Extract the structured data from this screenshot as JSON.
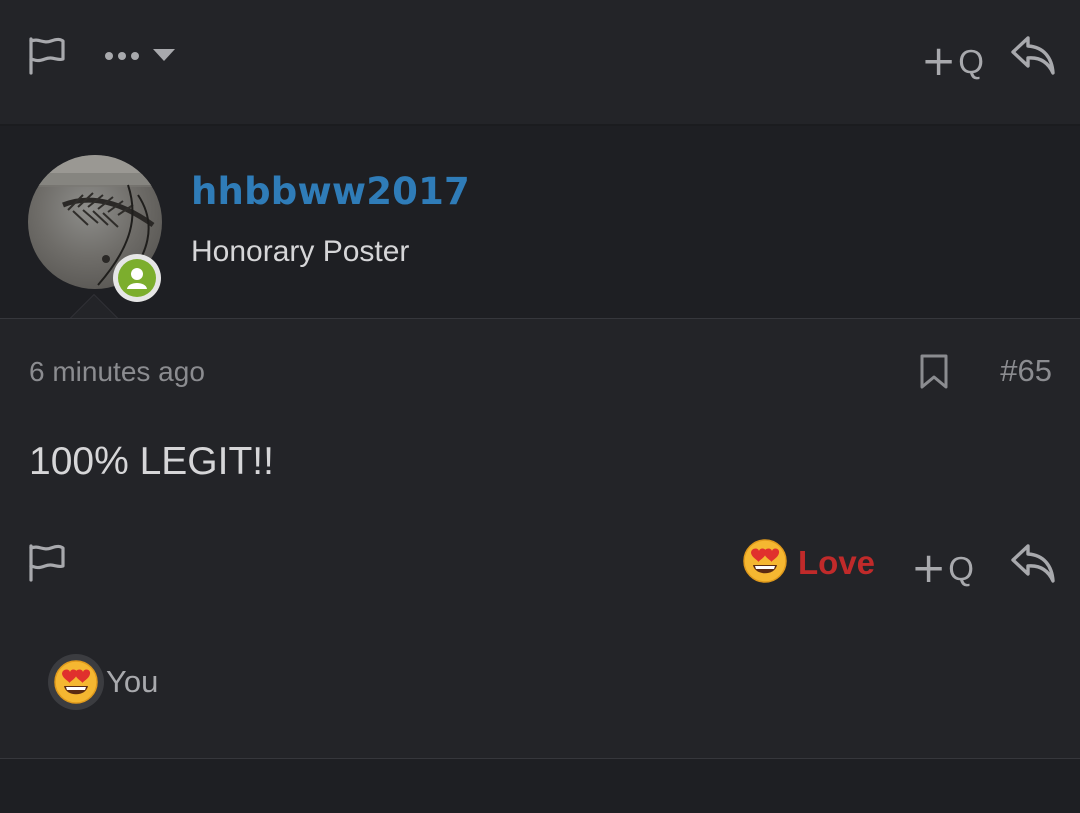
{
  "top_bar": {
    "flag_icon": "flag-icon",
    "more_icon": "ellipsis-icon",
    "more_caret_icon": "caret-down-icon",
    "quote_plus": "+",
    "quote_letter": "Q",
    "reply_icon": "reply-icon"
  },
  "user": {
    "username": "hhbbww2017",
    "title": "Honorary Poster",
    "avatar_icon": "user-avatar",
    "status_icon": "online-user-icon"
  },
  "post": {
    "timestamp": "6 minutes ago",
    "bookmark_icon": "bookmark-icon",
    "number": "#65",
    "body": "100% LEGIT!!"
  },
  "actions": {
    "flag_icon": "flag-icon",
    "reaction_icon": "heart-eyes-emoji",
    "reaction_label": "Love",
    "quote_plus": "+",
    "quote_letter": "Q",
    "reply_icon": "reply-icon"
  },
  "reactions": {
    "reactor_icon": "heart-eyes-emoji",
    "reactor_name": "You"
  },
  "colors": {
    "background": "#232428",
    "user_block_bg": "#1e1f23",
    "username": "#2f7cb8",
    "love": "#c02a2a",
    "muted": "#8b8c90",
    "online": "#7cae2d"
  }
}
